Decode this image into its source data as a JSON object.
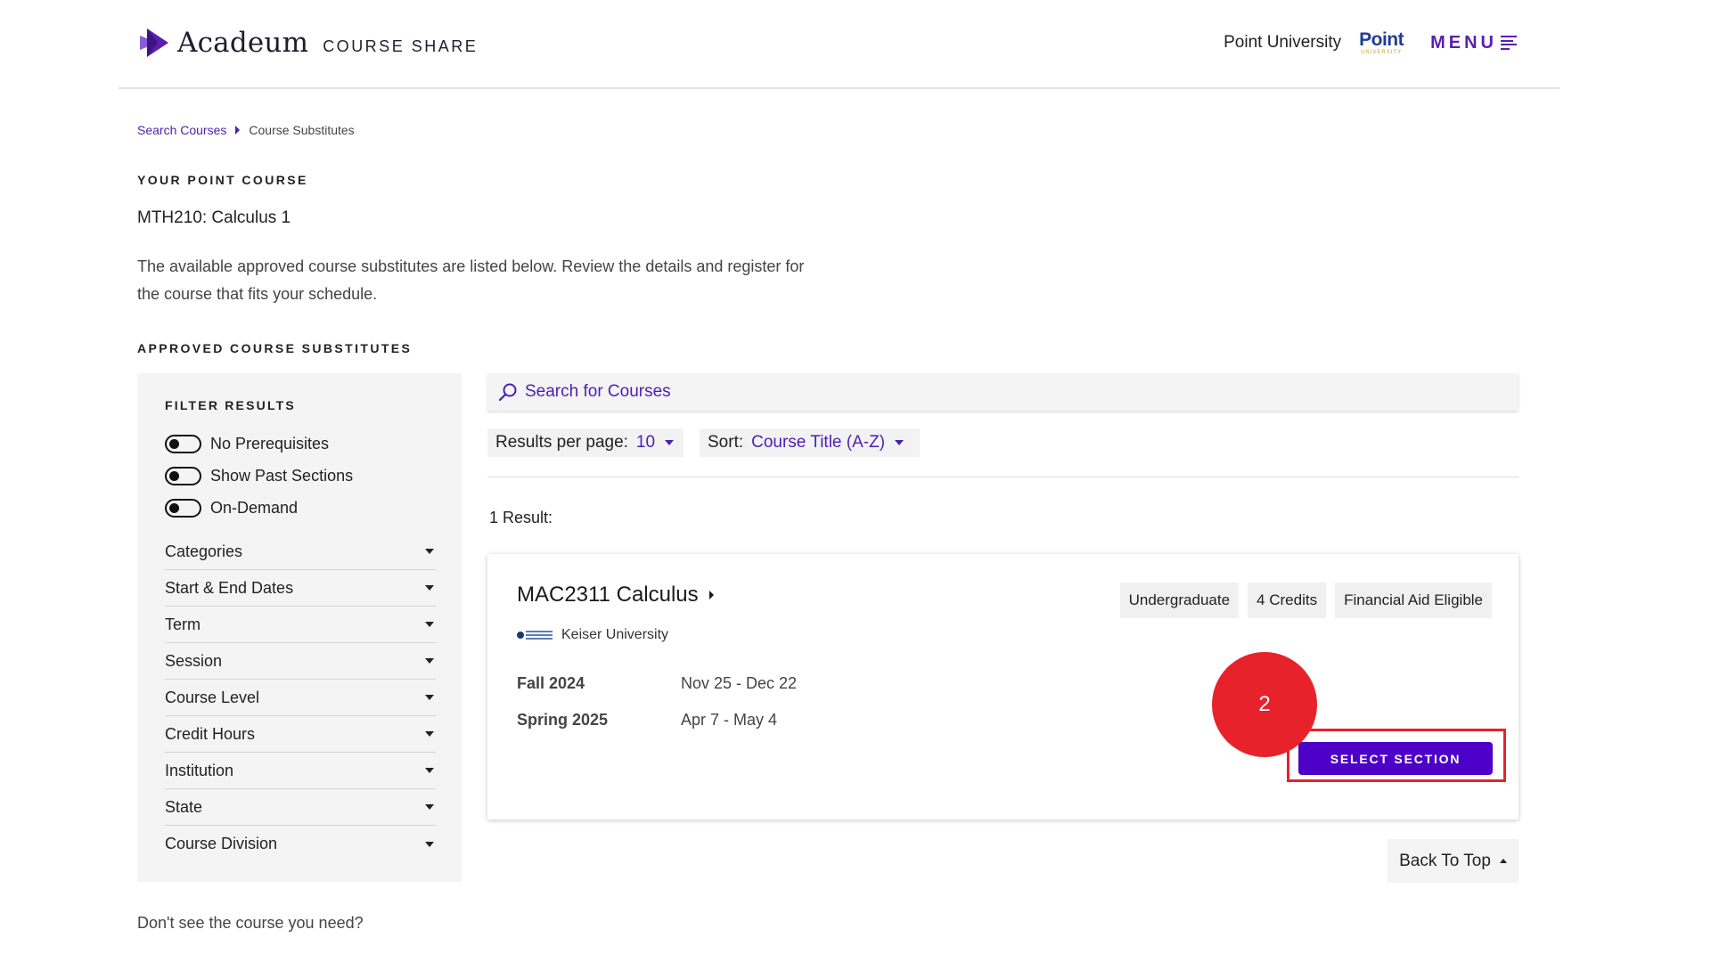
{
  "colors": {
    "accent": "#4d00c7",
    "link": "#4d1fb0",
    "highlight": "#e8222a"
  },
  "header": {
    "logo_name": "Acadeum",
    "logo_sub": "COURSE SHARE",
    "university_name": "Point University",
    "university_logo_main": "Point",
    "university_logo_sub": "UNIVERSITY",
    "menu_label": "MENU",
    "menu_icon": "hamburger-icon"
  },
  "breadcrumb": {
    "link": "Search Courses",
    "current": "Course Substitutes"
  },
  "your_course": {
    "label": "YOUR POINT COURSE",
    "course": "MTH210: Calculus 1",
    "intro": "The available approved course substitutes are listed below. Review the details and register for the course that fits your schedule."
  },
  "substitutes_label": "APPROVED COURSE SUBSTITUTES",
  "filters": {
    "title": "FILTER RESULTS",
    "toggles": [
      "No Prerequisites",
      "Show Past Sections",
      "On-Demand"
    ],
    "accordions": [
      "Categories",
      "Start & End Dates",
      "Term",
      "Session",
      "Course Level",
      "Credit Hours",
      "Institution",
      "State",
      "Course Division"
    ]
  },
  "search": {
    "placeholder": "Search for Courses",
    "icon": "search-icon"
  },
  "results_per_page": {
    "label": "Results per page:",
    "value": "10"
  },
  "sort": {
    "label": "Sort:",
    "value": "Course Title (A-Z)"
  },
  "result_count": "1 Result:",
  "result": {
    "title": "MAC2311 Calculus",
    "tags": [
      "Undergraduate",
      "4 Credits",
      "Financial Aid Eligible"
    ],
    "institution": "Keiser University",
    "terms": [
      {
        "name": "Fall 2024",
        "dates": "Nov 25 - Dec 22"
      },
      {
        "name": "Spring 2025",
        "dates": "Apr 7 - May 4"
      }
    ],
    "button_label": "SELECT SECTION"
  },
  "step_badge": "2",
  "back_to_top": "Back To Top",
  "dont_see": "Don't see the course you need?"
}
